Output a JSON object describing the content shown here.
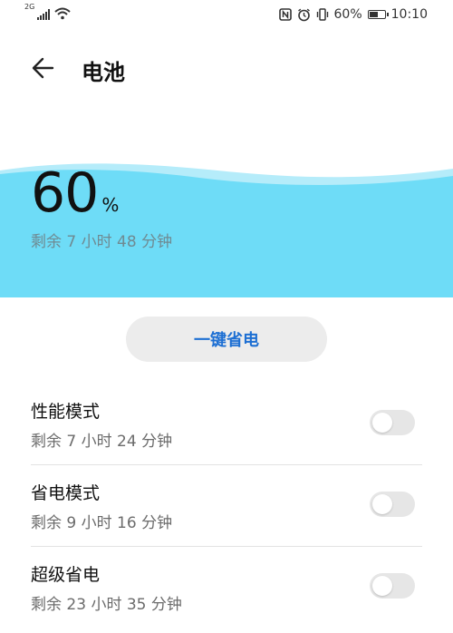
{
  "status_bar": {
    "network_tag": "2G",
    "battery_percent": "60%",
    "time": "10:10",
    "battery_level": 0.6
  },
  "header": {
    "title": "电池"
  },
  "battery": {
    "percent_value": "60",
    "percent_sign": "%",
    "remaining": "剩余 7 小时 48 分钟",
    "wave_color": "#6edcf7"
  },
  "actions": {
    "one_key_save_label": "一键省电"
  },
  "modes": [
    {
      "title": "性能模式",
      "subtitle": "剩余 7 小时 24 分钟",
      "enabled": false
    },
    {
      "title": "省电模式",
      "subtitle": "剩余 9 小时 16 分钟",
      "enabled": false
    },
    {
      "title": "超级省电",
      "subtitle": "剩余 23 小时 35 分钟",
      "enabled": false
    }
  ],
  "colors": {
    "accent": "#1d6fd3",
    "wave": "#6edcf7",
    "toggle_off": "#e6e6e6"
  }
}
